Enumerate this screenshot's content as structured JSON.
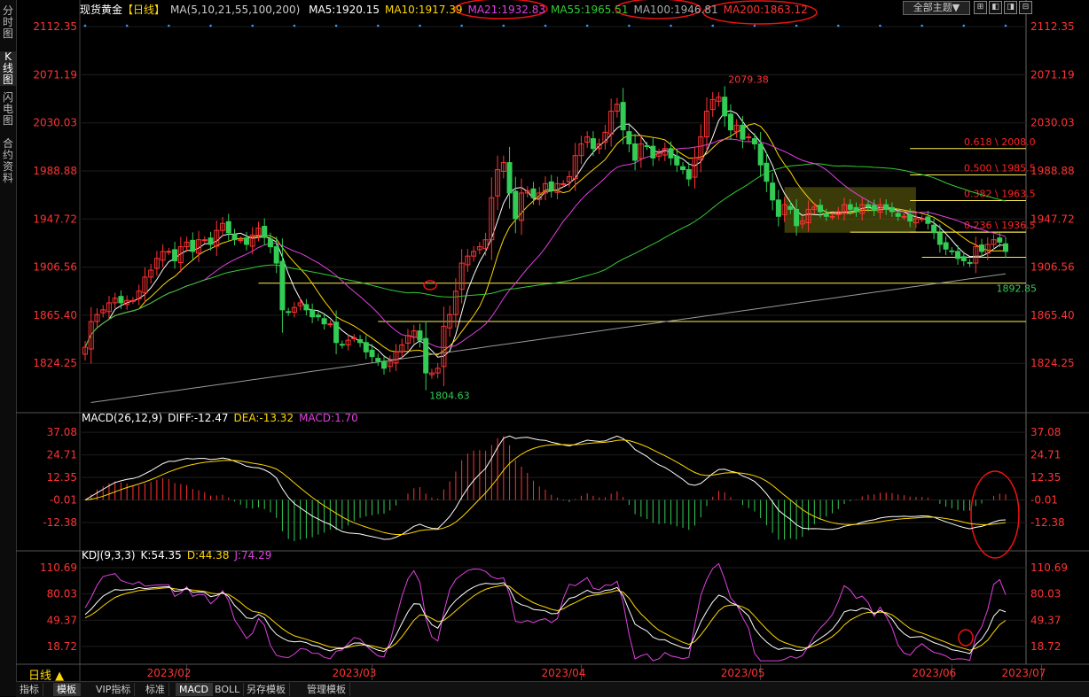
{
  "left_tabs": [
    "分时图",
    "K线图",
    "闪电图",
    "合约资料"
  ],
  "title": {
    "instrument": "现货黄金",
    "period_tag": "【日线】",
    "ma_label": "MA(5,10,21,55,100,200)",
    "ma_values": [
      {
        "label": "MA5:1920.15",
        "color": "#ffffff"
      },
      {
        "label": "MA10:1917.39",
        "color": "#ffd700"
      },
      {
        "label": "MA21:1932.83",
        "color": "#e040e0"
      },
      {
        "label": "MA55:1965.51",
        "color": "#33cc33"
      },
      {
        "label": "MA100:1946.81",
        "color": "#aaaaaa"
      },
      {
        "label": "MA200:1863.12",
        "color": "#ff3333"
      }
    ]
  },
  "toolbox": {
    "theme": "全部主题▼",
    "icons": [
      "fullscreen-icon",
      "prev-icon",
      "next-icon",
      "zoom-icon"
    ]
  },
  "chart_data": [
    {
      "type": "candlestick",
      "title": "现货黄金【日线】",
      "ylim": [
        1785,
        2120
      ],
      "y_ticks": [
        2112.35,
        2071.19,
        2030.03,
        1988.88,
        1947.72,
        1906.56,
        1865.4,
        1824.25
      ],
      "x_labels": [
        "2023/02",
        "2023/03",
        "2023/04",
        "2023/05",
        "2023/06",
        "2023/07"
      ],
      "close": [
        1838,
        1860,
        1866,
        1870,
        1876,
        1880,
        1876,
        1878,
        1878,
        1886,
        1898,
        1904,
        1914,
        1920,
        1920,
        1912,
        1924,
        1928,
        1920,
        1930,
        1930,
        1926,
        1938,
        1944,
        1936,
        1930,
        1930,
        1926,
        1934,
        1940,
        1932,
        1924,
        1910,
        1870,
        1868,
        1872,
        1876,
        1870,
        1864,
        1864,
        1858,
        1858,
        1842,
        1840,
        1844,
        1846,
        1842,
        1834,
        1830,
        1826,
        1820,
        1826,
        1834,
        1840,
        1848,
        1852,
        1844,
        1816,
        1816,
        1820,
        1856,
        1866,
        1886,
        1910,
        1916,
        1920,
        1924,
        1930,
        1966,
        1990,
        1996,
        1970,
        1948,
        1970,
        1972,
        1966,
        1970,
        1978,
        1972,
        1978,
        1978,
        1984,
        2002,
        2012,
        2018,
        2008,
        2012,
        2022,
        2040,
        2046,
        2024,
        2012,
        1998,
        2012,
        2010,
        2000,
        2004,
        2008,
        2000,
        1994,
        1990,
        1982,
        2000,
        2018,
        2040,
        2050,
        2052,
        2036,
        2024,
        2028,
        2016,
        2018,
        2012,
        1994,
        1980,
        1964,
        1950,
        1960,
        1956,
        1942,
        1946,
        1956,
        1958,
        1954,
        1950,
        1950,
        1954,
        1960,
        1956,
        1954,
        1960,
        1958,
        1955,
        1960,
        1956,
        1954,
        1950,
        1950,
        1946,
        1948,
        1948,
        1944,
        1936,
        1926,
        1922,
        1920,
        1914,
        1912,
        1910,
        1924,
        1920,
        1926,
        1930,
        1928,
        1920
      ],
      "highlights": {
        "high_label": "2079.38",
        "low_label": "1804.63",
        "recent_low_label": "1892.85"
      },
      "fib_levels": [
        {
          "label": "0.618 \\ 2008.0",
          "value": 2008.0
        },
        {
          "label": "0.500 \\ 1985.5",
          "value": 1985.5
        },
        {
          "label": "0.382 \\ 1963.5",
          "value": 1963.5
        },
        {
          "label": "0.236 \\ 1936.5",
          "value": 1936.5
        }
      ],
      "h_lines": [
        1936.5,
        1915,
        1892.85,
        1860
      ]
    },
    {
      "type": "bar",
      "title": "MACD(26,12,9)",
      "ylim": [
        -25,
        42
      ],
      "y_ticks": [
        37.08,
        24.71,
        12.35,
        -0.01,
        -12.38
      ],
      "x_labels": [
        "2023/02",
        "2023/03",
        "2023/04",
        "2023/05",
        "2023/06",
        "2023/07"
      ]
    },
    {
      "type": "line",
      "title": "KDJ(9,3,3)",
      "ylim": [
        0,
        120
      ],
      "y_ticks": [
        110.69,
        80.03,
        49.37,
        18.72
      ],
      "x_labels": [
        "2023/02",
        "2023/03",
        "2023/04",
        "2023/05",
        "2023/06",
        "2023/07"
      ]
    }
  ],
  "macd_title": [
    {
      "label": "MACD(26,12,9)",
      "color": "#ffffff"
    },
    {
      "label": "DIFF:-12.47",
      "color": "#ffffff"
    },
    {
      "label": "DEA:-13.32",
      "color": "#ffd700"
    },
    {
      "label": "MACD:1.70",
      "color": "#e040e0"
    }
  ],
  "kdj_title": [
    {
      "label": "KDJ(9,3,3)",
      "color": "#ffffff"
    },
    {
      "label": "K:54.35",
      "color": "#ffffff"
    },
    {
      "label": "D:44.38",
      "color": "#ffd700"
    },
    {
      "label": "J:74.29",
      "color": "#e040e0"
    }
  ],
  "period_label": "日线 ▲",
  "bottom_tabs": [
    "指标",
    "模板",
    "VIP指标",
    "标准",
    "MACD",
    "BOLL",
    "另存模板",
    "管理模板"
  ],
  "colors": {
    "up": "#ff3333",
    "down": "#33cc55",
    "grid": "#333333",
    "axis_text": "#ff3333",
    "fib_text": "#ff2222"
  }
}
